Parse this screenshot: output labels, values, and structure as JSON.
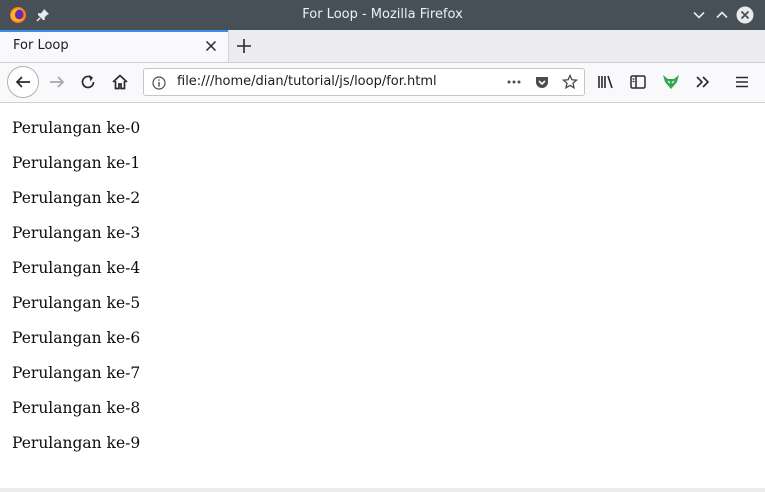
{
  "window": {
    "title": "For Loop - Mozilla Firefox"
  },
  "tabs": [
    {
      "label": "For Loop",
      "active": true
    }
  ],
  "navbar": {
    "url": "file:///home/dian/tutorial/js/loop/for.html"
  },
  "icons": {
    "app": "firefox-logo-icon",
    "pin": "pin-icon",
    "minimize": "chevron-down-icon",
    "maximize": "chevron-up-icon",
    "close": "close-circle-icon",
    "tab_close": "close-icon",
    "new_tab": "plus-icon",
    "back": "arrow-left-icon",
    "forward": "arrow-right-icon",
    "reload": "reload-icon",
    "home": "home-icon",
    "site_info": "info-icon",
    "page_actions": "ellipsis-icon",
    "pocket": "pocket-icon",
    "bookmark": "star-icon",
    "library": "library-icon",
    "sidebar": "sidebar-icon",
    "extension": "fox-extension-icon",
    "overflow": "double-chevron-right-icon",
    "menu": "hamburger-menu-icon"
  },
  "colors": {
    "titlebar": "#475057",
    "tab_accent": "#3a8ee6",
    "extension_green": "#2fa84f"
  },
  "content": {
    "lines": [
      "Perulangan ke-0",
      "Perulangan ke-1",
      "Perulangan ke-2",
      "Perulangan ke-3",
      "Perulangan ke-4",
      "Perulangan ke-5",
      "Perulangan ke-6",
      "Perulangan ke-7",
      "Perulangan ke-8",
      "Perulangan ke-9"
    ]
  }
}
